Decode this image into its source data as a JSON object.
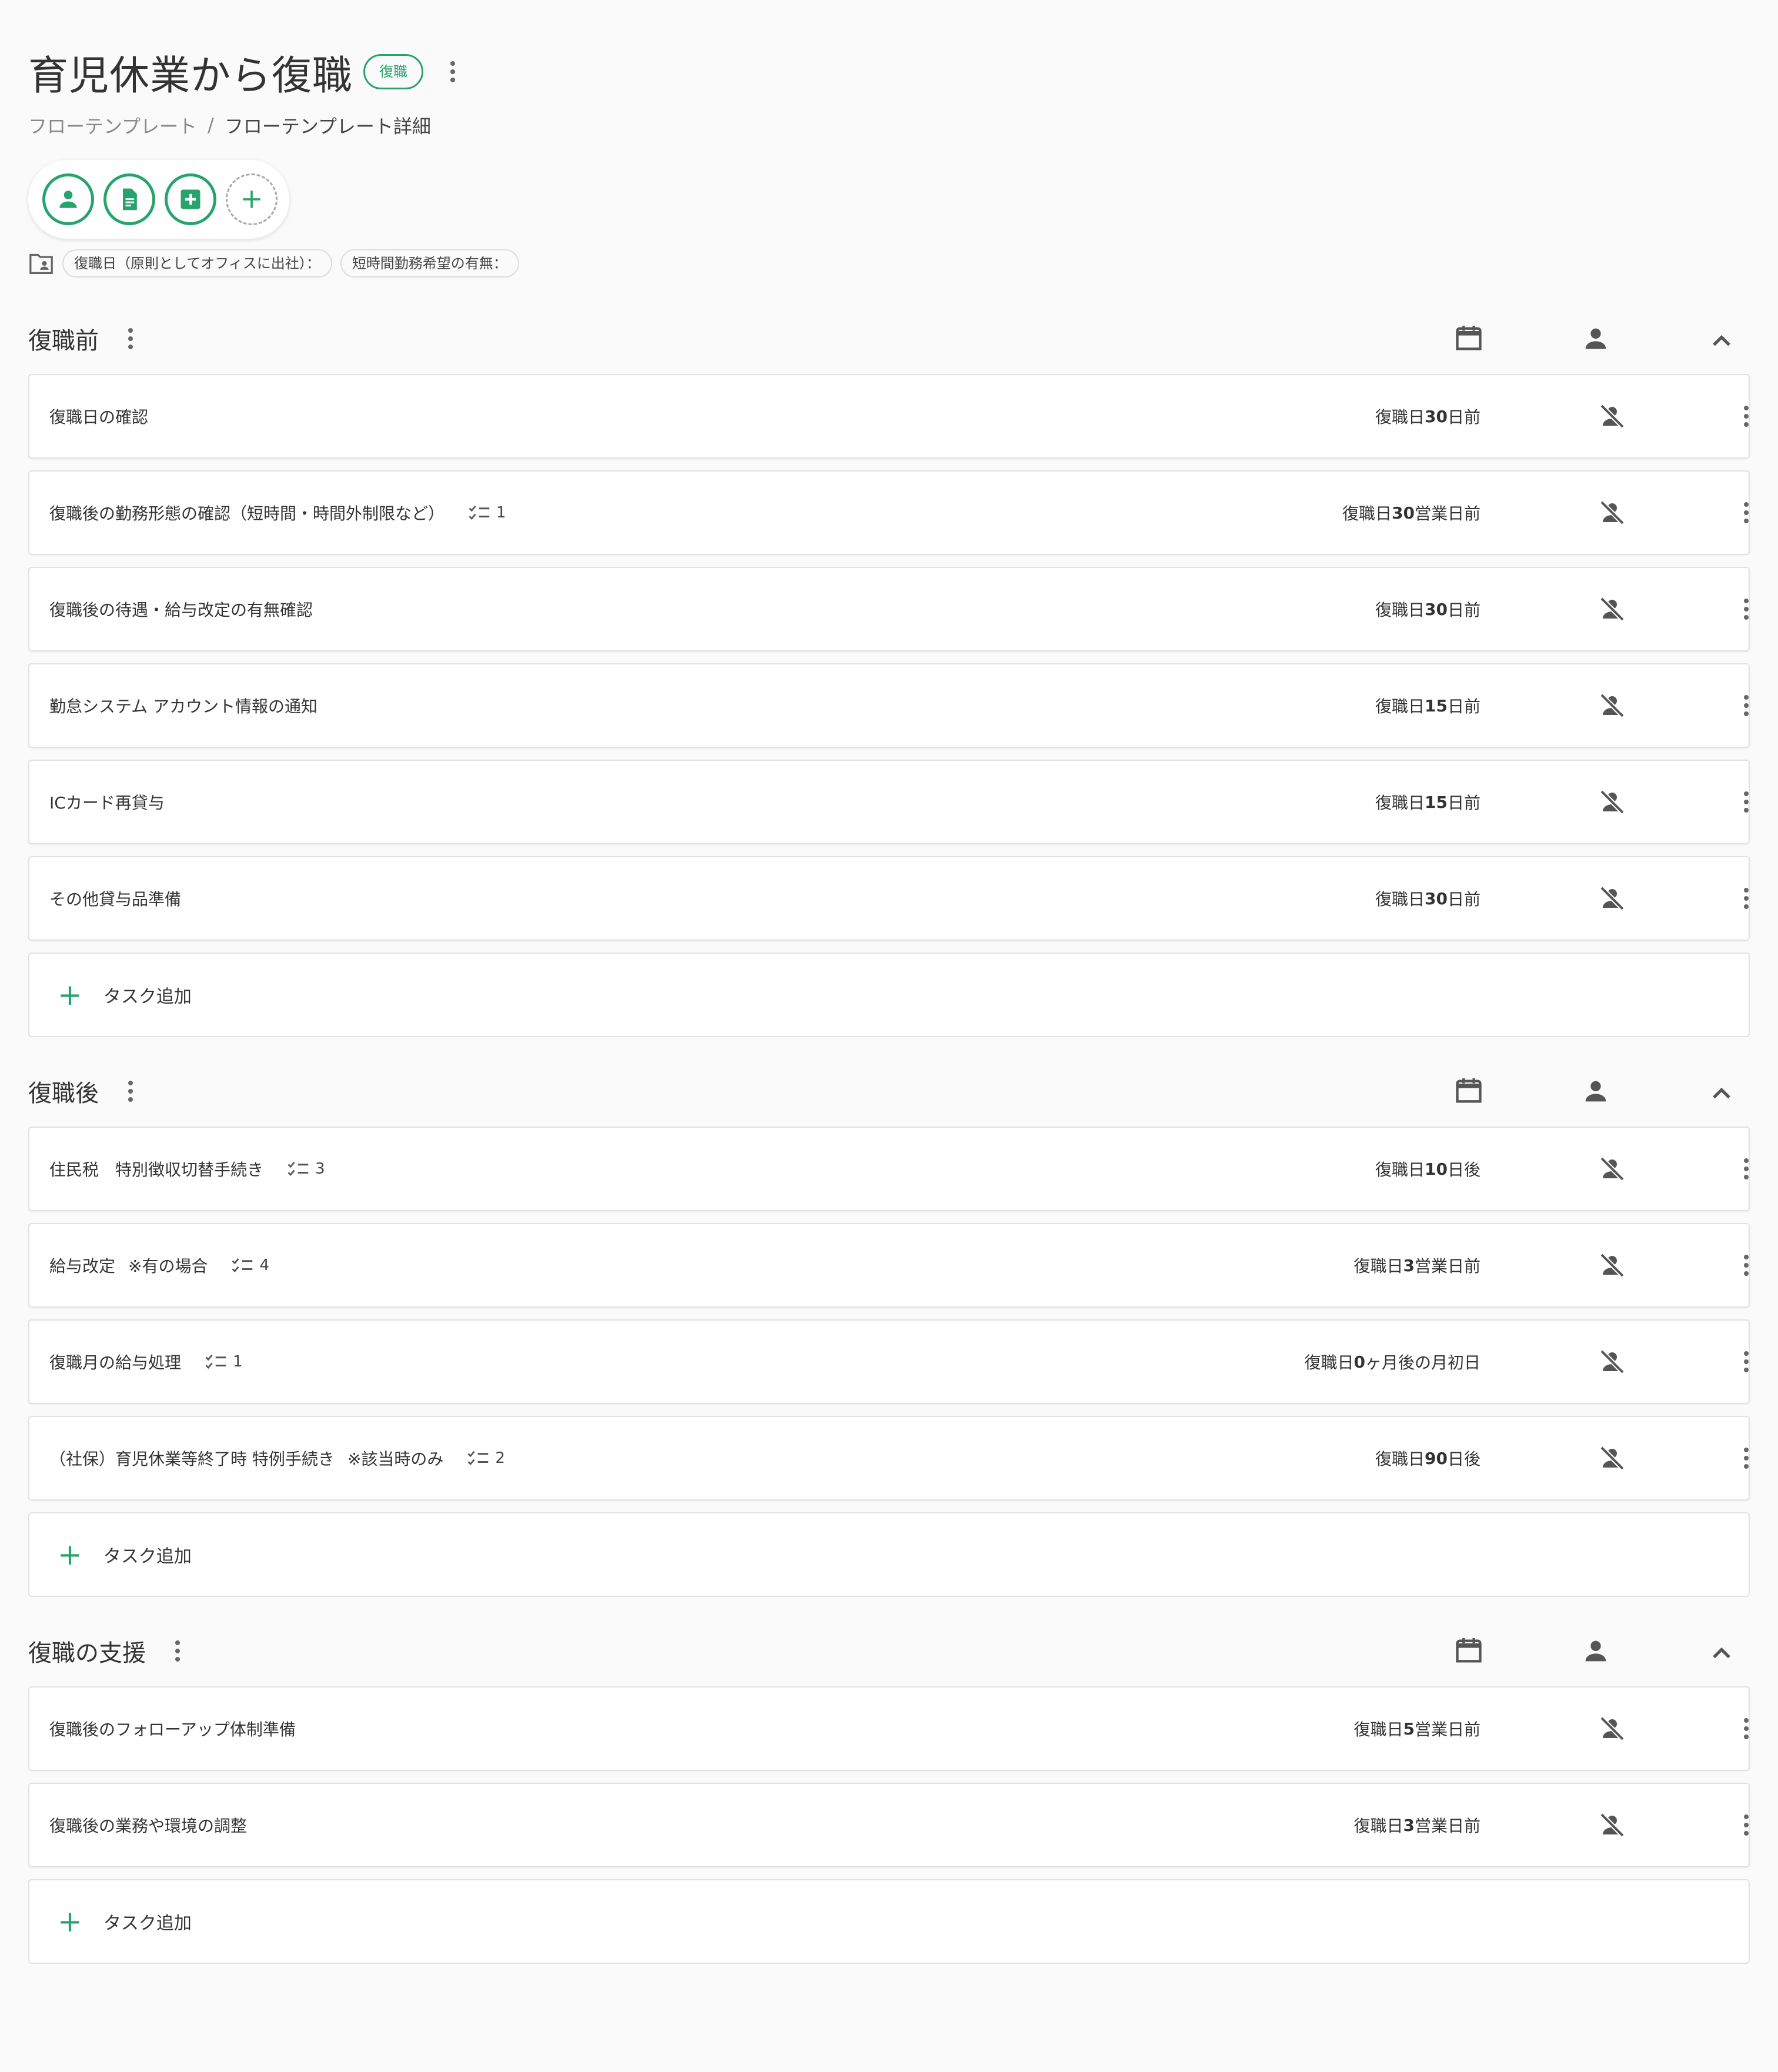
{
  "header": {
    "title": "育児休業から復職",
    "badge": "復職"
  },
  "breadcrumb": {
    "parent": "フローテンプレート",
    "separator": "/",
    "current": "フローテンプレート詳細"
  },
  "fields": [
    "復職日（原則としてオフィスに出社）：",
    "短時間勤務希望の有無："
  ],
  "add_task_label": "タスク追加",
  "colors": {
    "accent": "#27a36d"
  },
  "sections": [
    {
      "title": "復職前",
      "tasks": [
        {
          "name": "復職日の確認",
          "check": "",
          "note": "",
          "due_pre": "復職日",
          "due_num": "30",
          "due_post": "日前"
        },
        {
          "name": "復職後の勤務形態の確認（短時間・時間外制限など）",
          "check": "1",
          "note": "",
          "due_pre": "復職日",
          "due_num": "30",
          "due_post": "営業日前"
        },
        {
          "name": "復職後の待遇・給与改定の有無確認",
          "check": "",
          "note": "",
          "due_pre": "復職日",
          "due_num": "30",
          "due_post": "日前"
        },
        {
          "name": "勤怠システム アカウント情報の通知",
          "check": "",
          "note": "",
          "due_pre": "復職日",
          "due_num": "15",
          "due_post": "日前"
        },
        {
          "name": "ICカード再貸与",
          "check": "",
          "note": "",
          "due_pre": "復職日",
          "due_num": "15",
          "due_post": "日前"
        },
        {
          "name": "その他貸与品準備",
          "check": "",
          "note": "",
          "due_pre": "復職日",
          "due_num": "30",
          "due_post": "日前"
        }
      ]
    },
    {
      "title": "復職後",
      "tasks": [
        {
          "name": "住民税　特別徴収切替手続き",
          "check": "3",
          "note": "",
          "due_pre": "復職日",
          "due_num": "10",
          "due_post": "日後"
        },
        {
          "name": "給与改定",
          "check": "4",
          "note": "※有の場合",
          "due_pre": "復職日",
          "due_num": "3",
          "due_post": "営業日前"
        },
        {
          "name": "復職月の給与処理",
          "check": "1",
          "note": "",
          "due_pre": "復職日",
          "due_num": "0",
          "due_post": "ヶ月後の月初日"
        },
        {
          "name": "（社保）育児休業等終了時 特例手続き",
          "check": "2",
          "note": "※該当時のみ",
          "due_pre": "復職日",
          "due_num": "90",
          "due_post": "日後"
        }
      ]
    },
    {
      "title": "復職の支援",
      "tasks": [
        {
          "name": "復職後のフォローアップ体制準備",
          "check": "",
          "note": "",
          "due_pre": "復職日",
          "due_num": "5",
          "due_post": "営業日前"
        },
        {
          "name": "復職後の業務や環境の調整",
          "check": "",
          "note": "",
          "due_pre": "復職日",
          "due_num": "3",
          "due_post": "営業日前"
        }
      ]
    }
  ]
}
